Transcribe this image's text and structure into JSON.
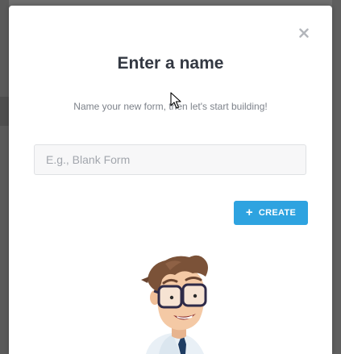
{
  "dialog": {
    "title": "Enter a name",
    "subtitle": "Name your new form, then let's start building!",
    "name_input": {
      "value": "",
      "placeholder": "E.g., Blank Form"
    },
    "create_button_label": "CREATE",
    "create_button_icon": "plus-icon",
    "close_icon": "close-icon"
  },
  "colors": {
    "accent": "#2ea3e0",
    "title": "#333842",
    "subtitle": "#7d828a",
    "backdrop": "#6e6e6e"
  }
}
